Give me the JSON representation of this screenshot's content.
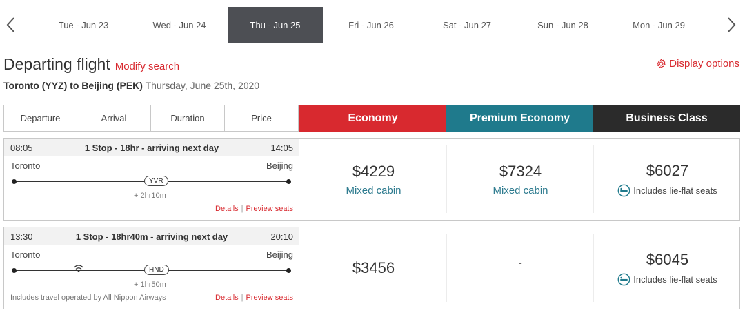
{
  "dates": {
    "prev_icon": "chevron-left-icon",
    "next_icon": "chevron-right-icon",
    "tabs": [
      {
        "label": "Tue - Jun 23"
      },
      {
        "label": "Wed - Jun 24"
      },
      {
        "label": "Thu - Jun 25",
        "active": true
      },
      {
        "label": "Fri - Jun 26"
      },
      {
        "label": "Sat - Jun 27"
      },
      {
        "label": "Sun - Jun 28"
      },
      {
        "label": "Mon - Jun 29"
      }
    ]
  },
  "header": {
    "title": "Departing flight",
    "modify": "Modify search",
    "display_options": "Display options",
    "display_icon": "gear-icon",
    "route": "Toronto (YYZ) to Beijing (PEK)",
    "date": "Thursday, June 25th, 2020"
  },
  "sort": {
    "departure": "Departure",
    "arrival": "Arrival",
    "duration": "Duration",
    "price": "Price"
  },
  "cabins": {
    "economy": {
      "label": "Economy",
      "color": "#d8292f"
    },
    "premium": {
      "label": "Premium Economy",
      "color": "#1f7a8c"
    },
    "business": {
      "label": "Business Class",
      "color": "#2b2b2b"
    }
  },
  "accent_color": "#d8292f",
  "flights": [
    {
      "depart_time": "08:05",
      "summary": "1 Stop - 18hr - arriving next day",
      "arrive_time": "14:05",
      "from": "Toronto",
      "to": "Beijing",
      "stop": "YVR",
      "layover": "+ 2hr10m",
      "details": "Details",
      "preview": "Preview seats",
      "separator": "|",
      "economy_price": "$4229",
      "economy_note": "Mixed cabin",
      "premium_price": "$7324",
      "premium_note": "Mixed cabin",
      "business_price": "$6027",
      "business_note": "Includes lie-flat seats",
      "business_icon": "lie-flat-seat-icon"
    },
    {
      "depart_time": "13:30",
      "summary": "1 Stop - 18hr40m - arriving next day",
      "arrive_time": "20:10",
      "from": "Toronto",
      "to": "Beijing",
      "stop": "HND",
      "wifi_icon": "wifi-icon",
      "layover": "+ 1hr50m",
      "operated": "Includes travel operated by All Nippon Airways",
      "details": "Details",
      "preview": "Preview seats",
      "separator": "|",
      "economy_price": "$3456",
      "premium_price": "-",
      "business_price": "$6045",
      "business_note": "Includes lie-flat seats",
      "business_icon": "lie-flat-seat-icon"
    }
  ]
}
